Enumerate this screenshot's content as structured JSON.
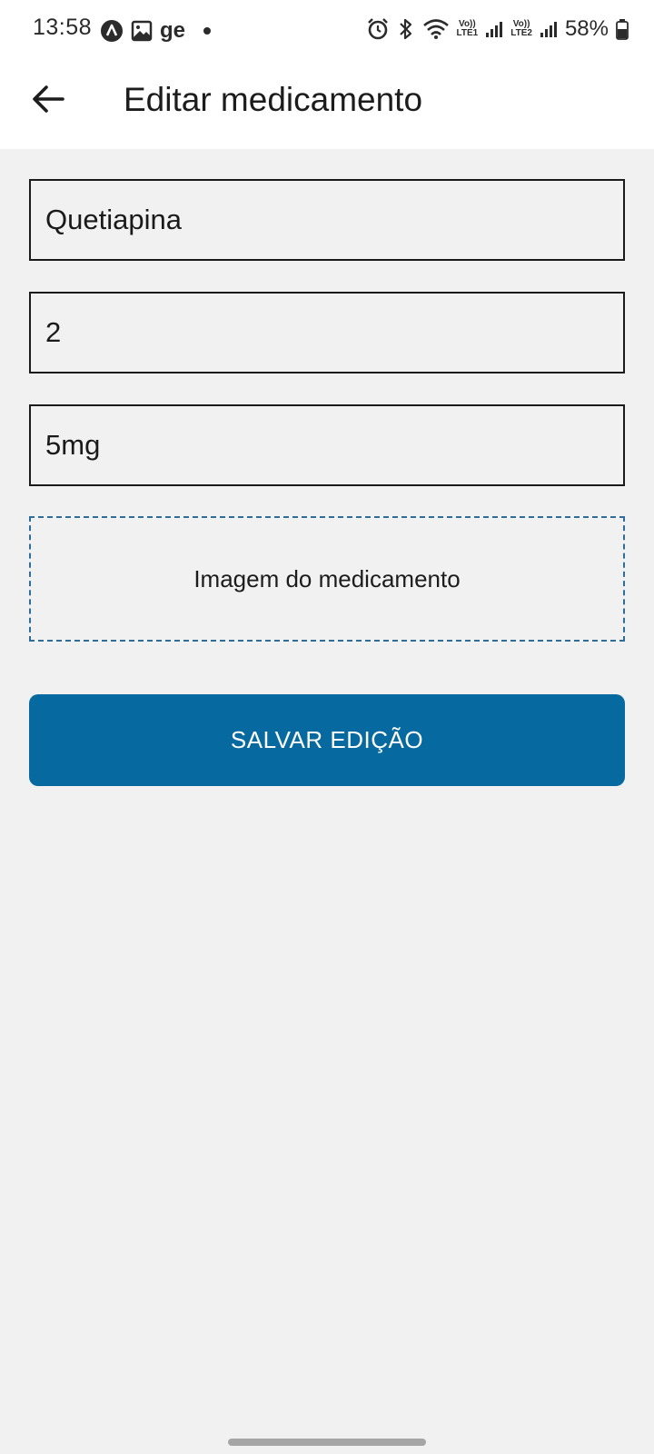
{
  "status_bar": {
    "time": "13:58",
    "left_text": "ge",
    "battery": "58%",
    "icons": [
      "app-a-icon",
      "gallery-icon",
      "notification-dot-icon",
      "alarm-icon",
      "bluetooth-icon",
      "wifi-icon",
      "volte-lte1-icon",
      "signal-icon",
      "volte-lte2-icon",
      "signal-icon",
      "battery-icon"
    ],
    "lte1_label": "LTE1",
    "lte2_label": "LTE2",
    "volte_label": "Vo))"
  },
  "header": {
    "title": "Editar medicamento",
    "back_icon": "arrow-left-icon"
  },
  "form": {
    "name_value": "Quetiapina",
    "quantity_value": "2",
    "dosage_value": "5mg",
    "image_label": "Imagem do medicamento",
    "save_label": "SALVAR EDIÇÃO"
  },
  "colors": {
    "primary": "#0669a0",
    "background": "#f1f1f2",
    "header_bg": "#ffffff",
    "dashed_border": "#2f6d9a"
  }
}
